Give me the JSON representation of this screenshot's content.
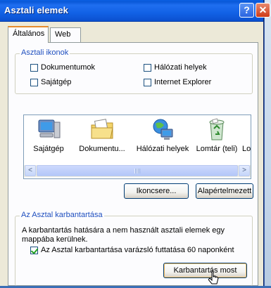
{
  "window": {
    "title": "Asztali elemek",
    "help_glyph": "?",
    "close_glyph": "✕"
  },
  "tabs": [
    {
      "label": "Általános",
      "active": true
    },
    {
      "label": "Web",
      "active": false
    }
  ],
  "desktop_icons_group": {
    "title": "Asztali ikonok",
    "checkboxes": [
      {
        "label": "Dokumentumok",
        "checked": false
      },
      {
        "label": "Hálózati helyek",
        "checked": false
      },
      {
        "label": "Sajátgép",
        "checked": false
      },
      {
        "label": "Internet Explorer",
        "checked": false
      }
    ]
  },
  "icon_list": {
    "items": [
      {
        "label": "Sajátgép",
        "icon": "my-computer-icon"
      },
      {
        "label": "Dokumentu...",
        "icon": "my-documents-icon"
      },
      {
        "label": "Hálózati helyek",
        "icon": "network-places-icon"
      },
      {
        "label": "Lomtár (teli)",
        "icon": "recycle-bin-full-icon"
      },
      {
        "label": "Lo",
        "icon": "recycle-bin-empty-icon"
      }
    ],
    "scroll_left_glyph": "<",
    "scroll_right_glyph": ">"
  },
  "buttons": {
    "change_icon": "Ikoncsere...",
    "restore_default": "Alapértelmezett"
  },
  "cleanup_group": {
    "title": "Az Asztal karbantartása",
    "description": "A karbantartás hatására a nem használt asztali elemek egy mappába kerülnek.",
    "checkbox_label": "Az Asztal karbantartása varázsló futtatása 60 naponként",
    "checkbox_checked": true,
    "button_label": "Karbantartás most"
  }
}
